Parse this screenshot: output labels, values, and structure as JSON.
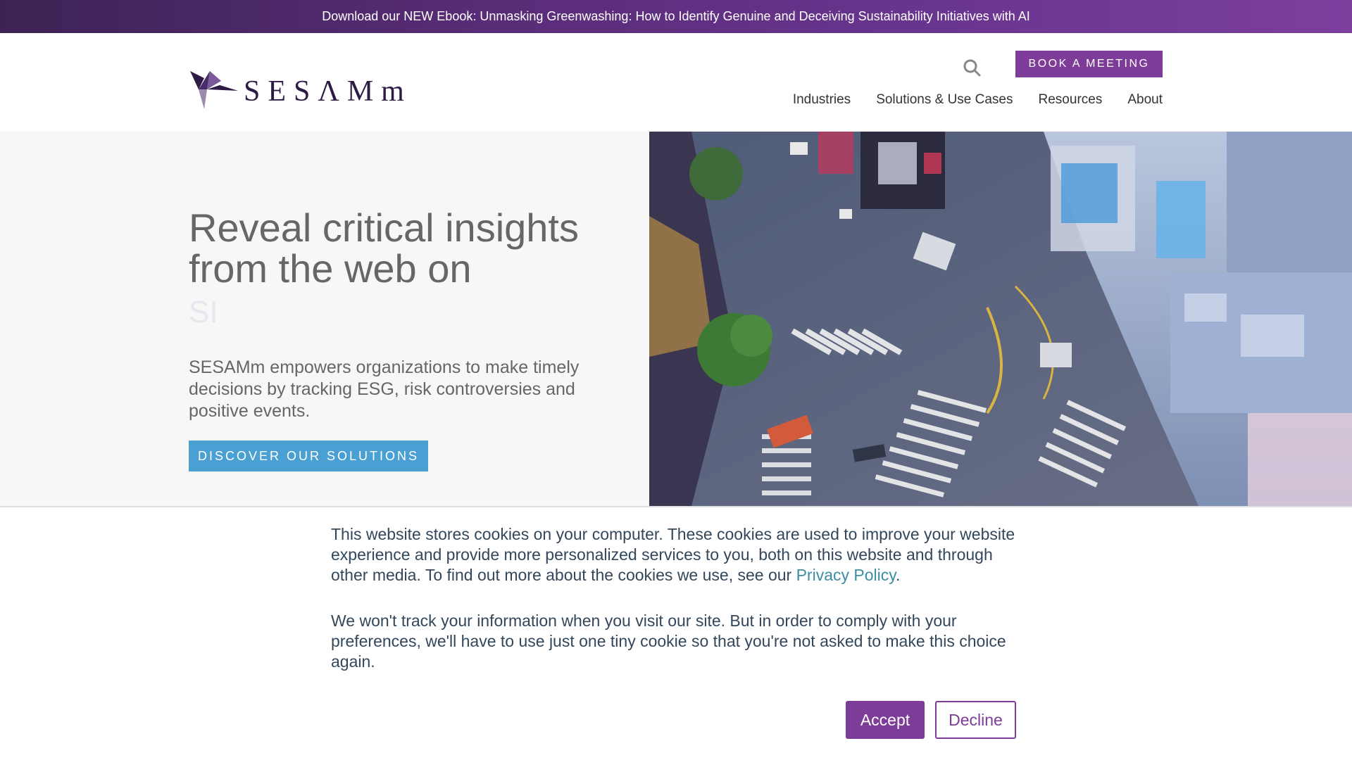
{
  "announcement": {
    "text": "Download our NEW Ebook: Unmasking Greenwashing: How to Identify Genuine and Deceiving Sustainability Initiatives with AI"
  },
  "header": {
    "logo_text": "SESΛMm",
    "book_meeting_label": "BOOK A MEETING",
    "nav": [
      {
        "label": "Industries"
      },
      {
        "label": "Solutions & Use Cases"
      },
      {
        "label": "Resources"
      },
      {
        "label": "About"
      }
    ]
  },
  "hero": {
    "title": "Reveal critical insights from the web on",
    "rotating_word": "SI",
    "description": "SESAMm empowers organizations to make timely decisions by tracking ESG, risk controversies and positive events.",
    "cta_label": "DISCOVER OUR SOLUTIONS"
  },
  "cookie_banner": {
    "paragraph1_text": "This website stores cookies on your computer. These cookies are used to improve your website experience and provide more personalized services to you, both on this website and through other media. To find out more about the cookies we use, see our ",
    "privacy_link": "Privacy Policy",
    "paragraph1_end": ".",
    "paragraph2": "We won't track your information when you visit our site. But in order to comply with your preferences, we'll have to use just one tiny cookie so that you're not asked to make this choice again.",
    "accept_label": "Accept",
    "decline_label": "Decline"
  },
  "colors": {
    "brand_purple": "#7d3c98",
    "cta_blue": "#4aa0d2",
    "link_teal": "#3b8ea5"
  },
  "icons": {
    "search": "search-icon",
    "logo": "sesamm-logo-icon"
  }
}
